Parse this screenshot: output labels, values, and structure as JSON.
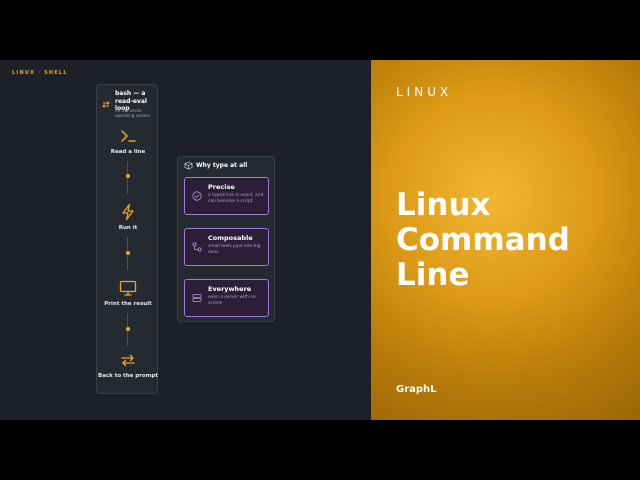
{
  "kicker": "LINUX · SHELL",
  "loop": {
    "title": "bash — a read-eval loop",
    "subtitle": "for the whole operating system",
    "steps": [
      {
        "label": "Read a line",
        "icon": "terminal-prompt-icon"
      },
      {
        "label": "Run it",
        "icon": "lightning-icon"
      },
      {
        "label": "Print the result",
        "icon": "monitor-icon"
      },
      {
        "label": "Back to the prompt",
        "icon": "cycle-arrows-icon"
      }
    ]
  },
  "why": {
    "title": "Why type at all",
    "cards": [
      {
        "title": "Precise",
        "desc": "a typed line is exact, and can become a script",
        "icon": "check-circle-icon"
      },
      {
        "title": "Composable",
        "desc": "small tools pipe into big ones",
        "icon": "pipe-nodes-icon"
      },
      {
        "title": "Everywhere",
        "desc": "even a server with no screen",
        "icon": "server-icon"
      }
    ]
  },
  "hero": {
    "top_label": "LINUX",
    "title_lines": [
      "Linux",
      "Command",
      "Line"
    ],
    "brand": "GraphL"
  },
  "colors": {
    "accent": "#e9a92a",
    "card_border": "#9d7bd6",
    "panel_bg": "#252a31",
    "left_bg": "#1d2127"
  }
}
